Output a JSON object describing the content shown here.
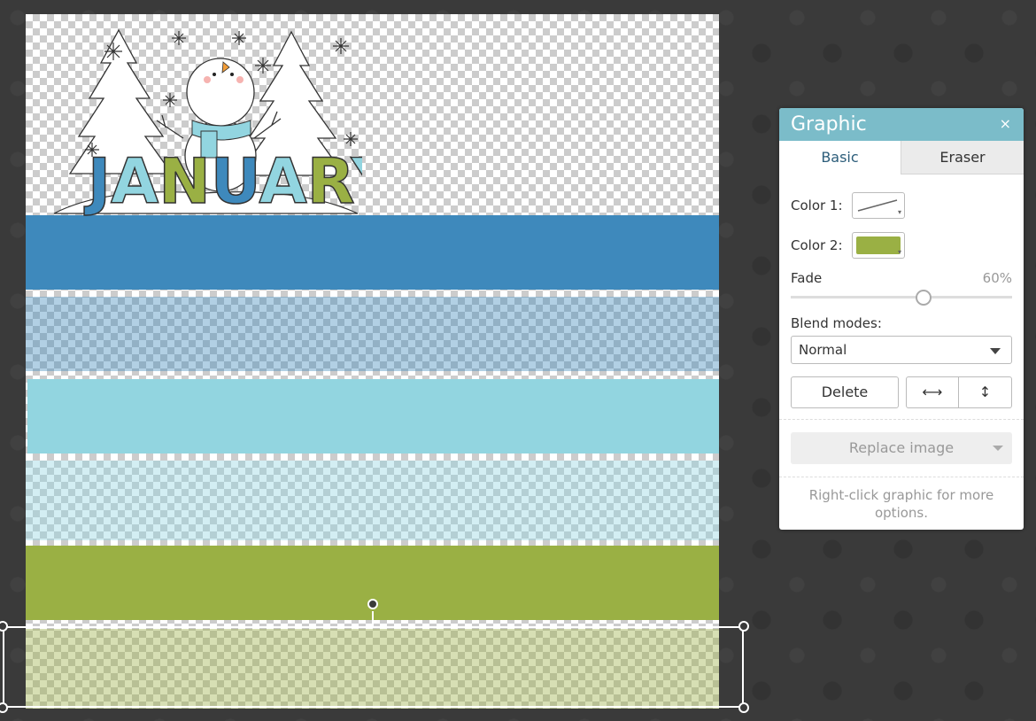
{
  "canvas": {
    "bands": [
      {
        "color": "#3e89bc"
      },
      {
        "color": "#3e89bc"
      },
      {
        "color": "#92d5e0"
      },
      {
        "color": "#92d5e0"
      },
      {
        "color": "#9ab044"
      },
      {
        "color": "#9ab044"
      }
    ],
    "clipart": {
      "text": "JANUARY",
      "letter_colors": [
        "#3e89bc",
        "#92d5e0",
        "#9ab044",
        "#3e89bc",
        "#92d5e0",
        "#9ab044",
        "#92d5e0"
      ]
    }
  },
  "panel": {
    "title": "Graphic",
    "close_icon": "×",
    "tabs": [
      {
        "label": "Basic",
        "active": true
      },
      {
        "label": "Eraser",
        "active": false
      }
    ],
    "color1": {
      "label": "Color 1:",
      "value": "none"
    },
    "color2": {
      "label": "Color 2:",
      "value": "#9ab044"
    },
    "fade": {
      "label": "Fade",
      "value_text": "60%",
      "value": 60
    },
    "blend": {
      "label": "Blend modes:",
      "selected": "Normal"
    },
    "delete_label": "Delete",
    "flip_horizontal_icon": "⟷",
    "flip_vertical_icon": "↕",
    "replace_label": "Replace image",
    "hint": "Right-click graphic for more options."
  }
}
